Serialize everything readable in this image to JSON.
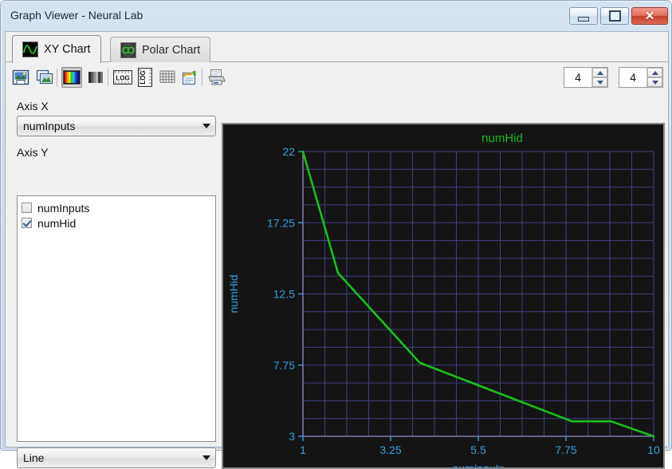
{
  "window": {
    "title": "Graph Viewer - Neural Lab",
    "controls": {
      "minimize": "minimize-button",
      "maximize": "maximize-button",
      "close_glyph": "✕"
    }
  },
  "tabs": [
    {
      "label": "XY Chart",
      "icon": "sine-wave-icon",
      "active": true
    },
    {
      "label": "Polar Chart",
      "icon": "polar-rose-icon",
      "active": false
    }
  ],
  "toolbar": {
    "buttons": [
      {
        "name": "save-image-button",
        "icon": "save-image-icon",
        "pressed": false
      },
      {
        "name": "copy-image-button",
        "icon": "copy-image-icon",
        "pressed": false
      },
      {
        "name": "color-palette-button",
        "icon": "color-palette-icon",
        "pressed": true
      },
      {
        "name": "gray-palette-button",
        "icon": "gray-palette-icon",
        "pressed": false
      },
      {
        "name": "log-x-button",
        "icon": "log-horizontal-icon",
        "pressed": false
      },
      {
        "name": "log-y-button",
        "icon": "log-vertical-icon",
        "pressed": false
      },
      {
        "name": "grid-button",
        "icon": "grid-icon",
        "pressed": false
      },
      {
        "name": "annotate-button",
        "icon": "notes-edit-icon",
        "pressed": false
      },
      {
        "name": "print-button",
        "icon": "printer-icon",
        "pressed": false
      }
    ],
    "spinner_left_value": "4",
    "spinner_right_value": "4"
  },
  "sidebar": {
    "axis_x_label": "Axis X",
    "axis_x_value": "numInputs",
    "axis_y_label": "Axis Y",
    "series_list": [
      {
        "label": "numInputs",
        "checked": false
      },
      {
        "label": "numHid",
        "checked": true
      }
    ],
    "plot_type_value": "Line"
  },
  "colors": {
    "plot_background": "#141414",
    "grid": "#3b3f86",
    "axis": "#8f93c9",
    "tick_text": "#2f9fe0",
    "axis_label": "#2f9fe0",
    "series": "#17c017",
    "title": "#18bd18"
  },
  "chart_data": {
    "type": "line",
    "title": "numHid",
    "xlabel": "numInputs",
    "ylabel": "numHid",
    "xlim": [
      1,
      10
    ],
    "ylim": [
      3,
      22
    ],
    "xticks": [
      "1",
      "3.25",
      "5.5",
      "7.75",
      "10"
    ],
    "xtick_values": [
      1,
      3.25,
      5.5,
      7.75,
      10
    ],
    "yticks": [
      "22",
      "17.25",
      "12.5",
      "7.75",
      "3"
    ],
    "ytick_values": [
      22,
      17.25,
      12.5,
      7.75,
      3
    ],
    "grid": true,
    "legend": "none",
    "series": [
      {
        "name": "numHid",
        "color": "#17c017",
        "x": [
          1,
          1.9,
          4.0,
          7.9,
          8.9,
          10
        ],
        "y": [
          22,
          13.9,
          7.9,
          4.0,
          4.0,
          3.0
        ]
      }
    ]
  }
}
